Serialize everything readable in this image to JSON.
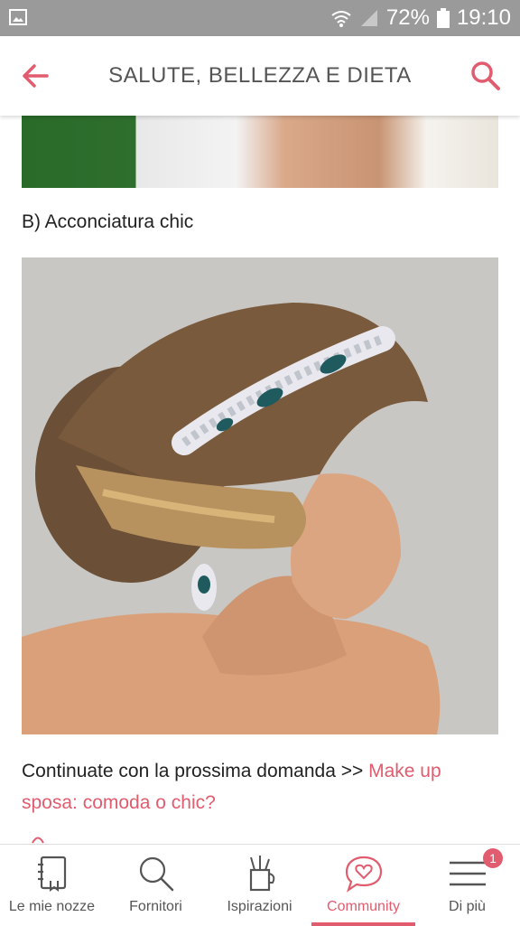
{
  "status_bar": {
    "battery": "72%",
    "time": "19:10"
  },
  "app_bar": {
    "title": "SALUTE, BELLEZZA E DIETA",
    "back_icon": "back-arrow-icon",
    "search_icon": "search-icon",
    "accent_color": "#e05c6e"
  },
  "content": {
    "heading": "B) Acconciatura chic",
    "paragraph_text": "Continuate con la prossima domanda >> ",
    "paragraph_link": "Make up sposa: comoda o chic?"
  },
  "bottom_nav": {
    "items": [
      {
        "label": "Le mie nozze",
        "icon": "notebook-icon"
      },
      {
        "label": "Fornitori",
        "icon": "search-icon"
      },
      {
        "label": "Ispirazioni",
        "icon": "pencil-cup-icon"
      },
      {
        "label": "Community",
        "icon": "heart-chat-icon",
        "active": true
      },
      {
        "label": "Di più",
        "icon": "menu-icon",
        "badge": "1"
      }
    ]
  }
}
